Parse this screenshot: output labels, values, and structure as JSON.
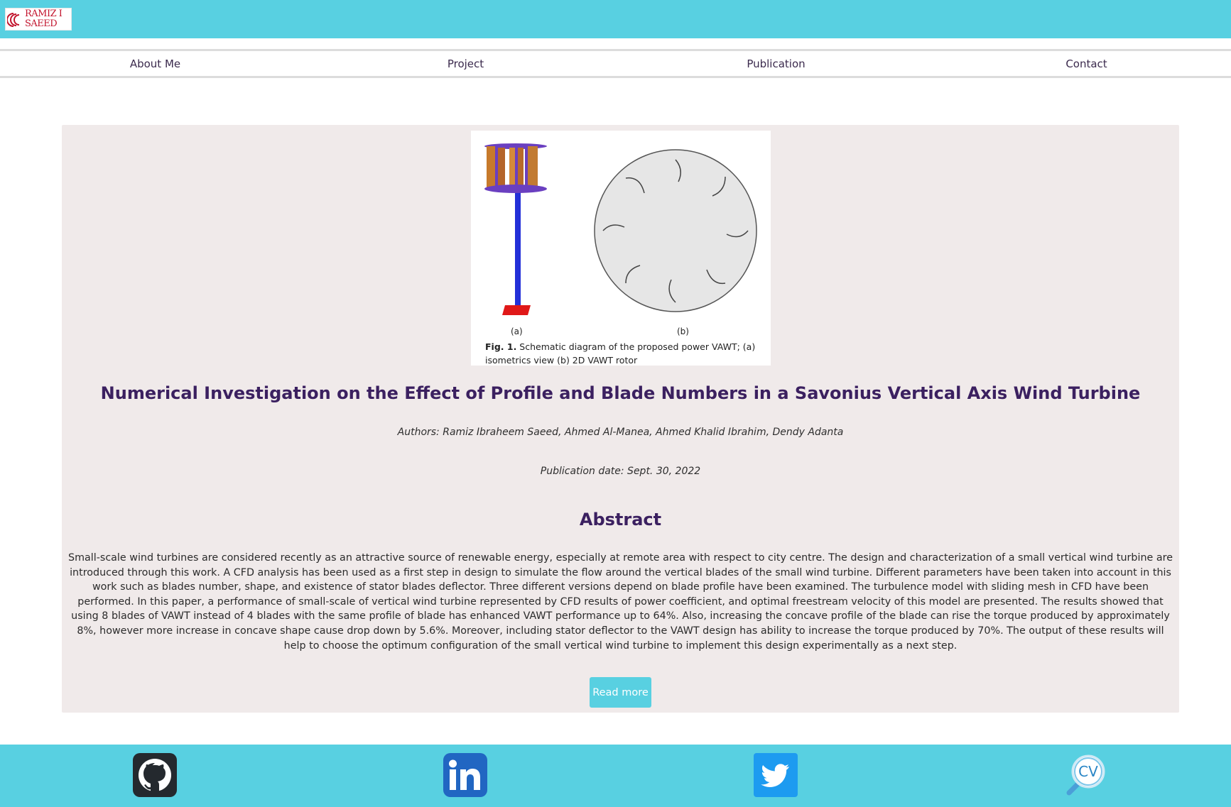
{
  "header": {
    "logo_line1": "RAMIZ I",
    "logo_line2": "SAEED",
    "brand_color": "#c2142d",
    "bar_color": "#58d0e1"
  },
  "nav": {
    "items": [
      {
        "label": "About Me"
      },
      {
        "label": "Project"
      },
      {
        "label": "Publication"
      },
      {
        "label": "Contact"
      }
    ]
  },
  "publication": {
    "figure": {
      "sub_a": "(a)",
      "sub_b": "(b)",
      "caption_bold": "Fig. 1.",
      "caption_text": " Schematic diagram of the proposed power VAWT; (a) isometrics view (b) 2D VAWT rotor"
    },
    "title": "Numerical Investigation on the Effect of Profile and Blade Numbers in a Savonius Vertical Axis Wind Turbine",
    "authors": "Authors: Ramiz Ibraheem Saeed, Ahmed Al-Manea, Ahmed Khalid Ibrahim, Dendy Adanta",
    "date": "Publication date: Sept. 30, 2022",
    "abstract_heading": "Abstract",
    "abstract": "Small-scale wind turbines are considered recently as an attractive source of renewable energy, especially at remote area with respect to city centre. The design and characterization of a small vertical wind turbine are introduced through this work. A CFD analysis has been used as a first step in design to simulate the flow around the vertical blades of the small wind turbine. Different parameters have been taken into account in this work such as blades number, shape, and existence of stator blades deflector. Three different versions depend on blade profile have been examined. The turbulence model with sliding mesh in CFD have been performed. In this paper, a performance of small-scale of vertical wind turbine represented by CFD results of power coefficient, and optimal freestream velocity of this model are presented. The results showed that using 8 blades of VAWT instead of 4 blades with the same profile of blade has enhanced VAWT performance up to 64%. Also, increasing the concave profile of the blade can rise the torque produced by approximately 8%, however more increase in concave shape cause drop down by 5.6%. Moreover, including stator deflector to the VAWT design has ability to increase the torque produced by 70%. The output of these results will help to choose the optimum configuration of the small vertical wind turbine to implement this design experimentally as a next step.",
    "read_more": "Read more"
  },
  "footer": {
    "icons": [
      "github-icon",
      "linkedin-icon",
      "twitter-icon",
      "cv-icon"
    ],
    "cv_label": "CV"
  }
}
